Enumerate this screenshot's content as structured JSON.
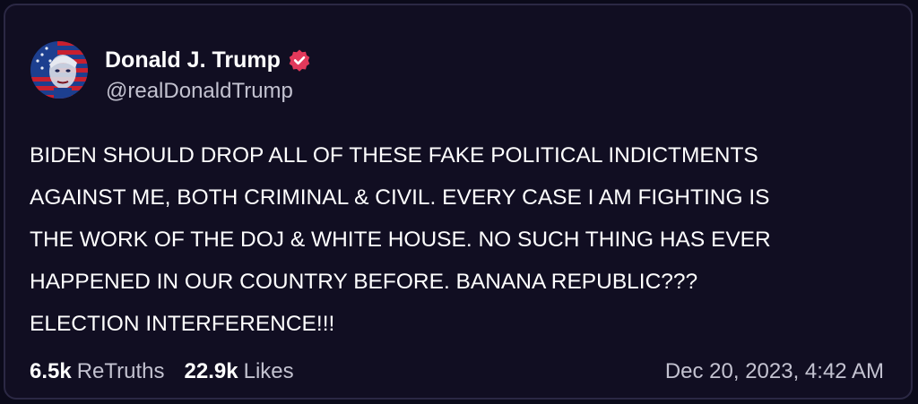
{
  "post": {
    "display_name": "Donald J. Trump",
    "handle": "@realDonaldTrump",
    "avatar_icon": "user-avatar-flag",
    "verified_icon": "verified-badge-icon",
    "verified_color": "#e2395b",
    "body_lines": [
      "BIDEN SHOULD DROP ALL OF THESE FAKE POLITICAL INDICTMENTS",
      "AGAINST ME, BOTH CRIMINAL & CIVIL. EVERY CASE I AM FIGHTING IS",
      "THE WORK OF THE DOJ & WHITE HOUSE. NO SUCH THING HAS EVER",
      "HAPPENED IN OUR COUNTRY BEFORE. BANANA REPUBLIC???",
      "ELECTION INTERFERENCE!!!"
    ],
    "retruths_count": "6.5k",
    "retruths_label": "ReTruths",
    "likes_count": "22.9k",
    "likes_label": "Likes",
    "timestamp": "Dec 20, 2023, 4:42 AM"
  },
  "colors": {
    "background": "#0b0a1a",
    "card": "#110e22",
    "text_primary": "#ffffff",
    "text_secondary": "#c3c2d0"
  }
}
